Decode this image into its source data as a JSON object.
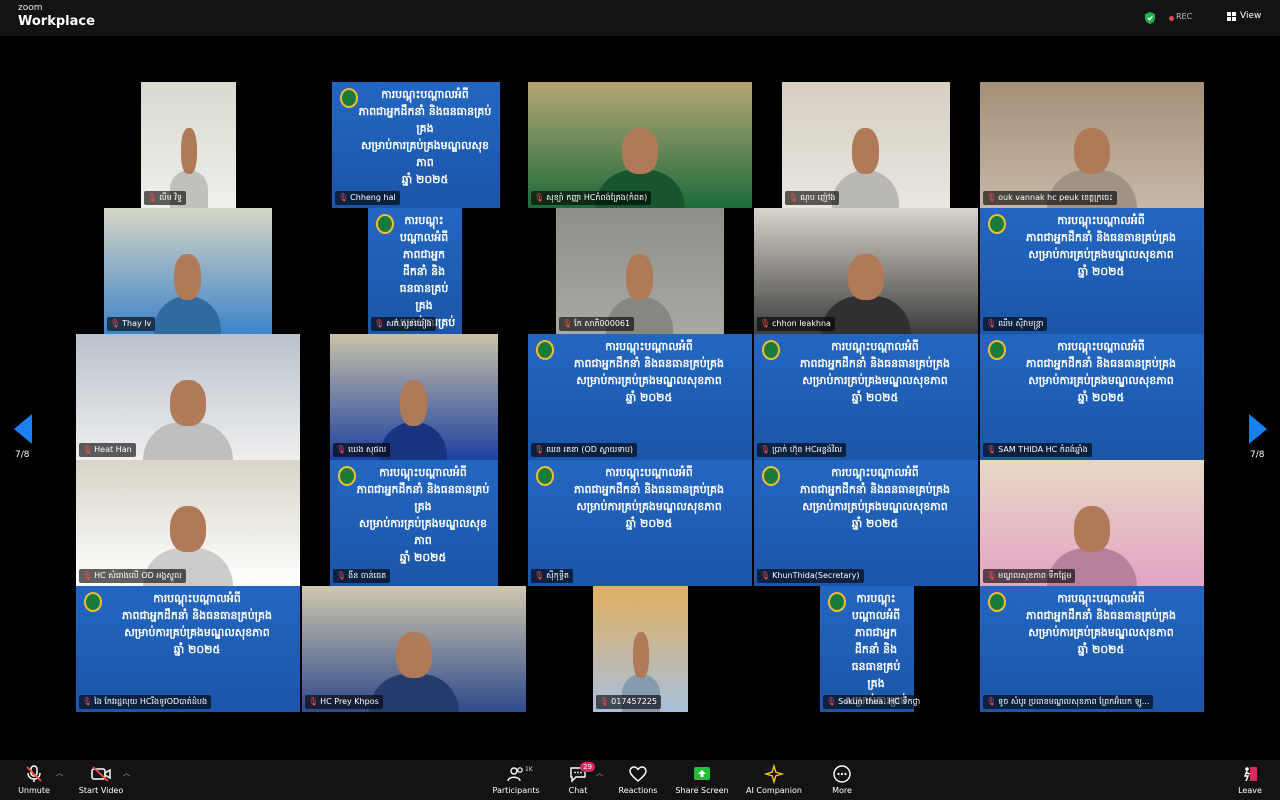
{
  "app": {
    "brand_small": "zoom",
    "brand_big": "Workplace"
  },
  "topbar": {
    "rec_label": "REC",
    "view_label": "View"
  },
  "pager": {
    "left_label": "7/8",
    "right_label": "7/8"
  },
  "slide_text": "ការបណ្ដុះបណ្ដាលអំពី\nភាពជាអ្នកដឹកនាំ និងធនធានគ្រប់គ្រង\nសម្រាប់ការគ្រប់គ្រងមណ្ឌលសុខភាព\nឆ្នាំ ២០២៥",
  "participants": [
    "លីម វិទ្ធ",
    "Chheng hal",
    "សុខ្យ៉ា កញ្ញា HCកំពង់ត្រែង(កំពត)",
    "ណុប ញ៉ៅង",
    "ouk vannak hc peuk ខេត្តក្រចេះ",
    "Thay lv",
    "សក់ សុខឃៀង",
    "កែ សាភិ000061",
    "chhon leakhna",
    "ឈឹម ស៊ីវាមន្ត្រា",
    "Heat Han",
    "ឃេង សុផល",
    "ឈន រតនា (OD ស្វាយទាប)",
    "ប្រាក់ ហ៊ុន HCអន្លង់វិល",
    "SAM THIDA HC កំពង់ឆ្នាំង",
    "HC សំរោងលើ OD អង្គស្នួល",
    "ងីន ចាន់ធេត",
    "ស៊ីកុទ្ធីត",
    "KhunThida(Secretary)",
    "មណ្ឌលសុខភាព ទឹកផ្អែម",
    "ងៃ កែវរដ្ឋលុយ HCរីងទូវODបាត់ដំបង",
    "HC Prey Khpos",
    "017457225",
    "Sokun thea. HC ទឹកថ្លា",
    "ទូច សំបូរ ប្រធានមណ្ឌលសុខភាព ព្រែកអ៊ំបេក ឡូ..."
  ],
  "toolbar": {
    "unmute": "Unmute",
    "start_video": "Start Video",
    "participants": "Participants",
    "participants_count": "1K",
    "chat": "Chat",
    "chat_badge": "29",
    "reactions": "Reactions",
    "share_screen": "Share Screen",
    "ai_companion": "AI Companion",
    "more": "More",
    "leave": "Leave"
  },
  "colors": {
    "accent_blue": "#1a7ff0",
    "slide_blue": "#1f5fb5",
    "mute_red": "#ff4a4a",
    "share_green": "#1fbf3a",
    "badge_pink": "#e0245e"
  }
}
